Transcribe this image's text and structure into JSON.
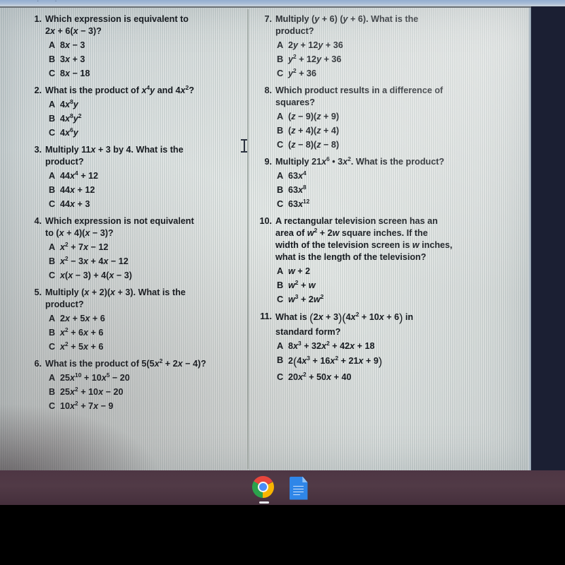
{
  "device": {
    "shelf_color": "#4e3644",
    "desktop_color": "#1b1f33",
    "paper_color": "#dfe5e2"
  },
  "shelf": {
    "items": [
      {
        "name": "chrome-icon",
        "label": "Google Chrome",
        "active": true
      },
      {
        "name": "google-docs-icon",
        "label": "Google Docs",
        "active": false
      }
    ]
  },
  "worksheet": {
    "columns": [
      {
        "id": "left-column",
        "questions": [
          {
            "number": "1.",
            "text_html": "Which expression is equivalent to<br>2<i class=\"v\">x</i> + 6(<i class=\"v\">x</i> &minus; 3)?",
            "options": [
              {
                "letter": "A",
                "html": "8<i class=\"v\">x</i> &minus; 3"
              },
              {
                "letter": "B",
                "html": "3<i class=\"v\">x</i> + 3"
              },
              {
                "letter": "C",
                "html": "8<i class=\"v\">x</i> &minus; 18"
              }
            ]
          },
          {
            "number": "2.",
            "text_html": "What is the product of <i class=\"v\">x</i><sup>4</sup><i class=\"v\">y</i> and 4<i class=\"v\">x</i><sup>2</sup>?",
            "options": [
              {
                "letter": "A",
                "html": "4<i class=\"v\">x</i><sup>8</sup><i class=\"v\">y</i>"
              },
              {
                "letter": "B",
                "html": "4<i class=\"v\">x</i><sup>8</sup><i class=\"v\">y</i><sup>2</sup>"
              },
              {
                "letter": "C",
                "html": "4<i class=\"v\">x</i><sup>6</sup><i class=\"v\">y</i>"
              }
            ]
          },
          {
            "number": "3.",
            "text_html": "Multiply 11<i class=\"v\">x</i> + 3 by 4. What is the<br>product?",
            "options": [
              {
                "letter": "A",
                "html": "44<i class=\"v\">x</i><sup>4</sup> + 12"
              },
              {
                "letter": "B",
                "html": "44<i class=\"v\">x</i> + 12"
              },
              {
                "letter": "C",
                "html": "44<i class=\"v\">x</i> + 3"
              }
            ]
          },
          {
            "number": "4.",
            "text_html": "Which expression is <b>not</b> equivalent<br>to (<i class=\"v\">x</i> + 4)(<i class=\"v\">x</i> &minus; 3)?",
            "options": [
              {
                "letter": "A",
                "html": "<i class=\"v\">x</i><sup>2</sup> + 7<i class=\"v\">x</i> &minus; 12"
              },
              {
                "letter": "B",
                "html": "<i class=\"v\">x</i><sup>2</sup> &minus; 3<i class=\"v\">x</i> + 4<i class=\"v\">x</i> &minus; 12"
              },
              {
                "letter": "C",
                "html": "<i class=\"v\">x</i>(<i class=\"v\">x</i> &minus; 3) + 4(<i class=\"v\">x</i> &minus; 3)"
              }
            ]
          },
          {
            "number": "5.",
            "text_html": "Multiply (<i class=\"v\">x</i> + 2)(<i class=\"v\">x</i> + 3). What is the<br>product?",
            "options": [
              {
                "letter": "A",
                "html": "2<i class=\"v\">x</i> + 5<i class=\"v\">x</i> + 6"
              },
              {
                "letter": "B",
                "html": "<i class=\"v\">x</i><sup>2</sup> + 6<i class=\"v\">x</i> + 6"
              },
              {
                "letter": "C",
                "html": "<i class=\"v\">x</i><sup>2</sup> + 5<i class=\"v\">x</i> + 6"
              }
            ]
          },
          {
            "number": "6.",
            "text_html": "What is the product of 5(5<i class=\"v\">x</i><sup>2</sup> + 2<i class=\"v\">x</i> &minus; 4)?",
            "options": [
              {
                "letter": "A",
                "html": "25<i class=\"v\">x</i><sup>10</sup> + 10<i class=\"v\">x</i><sup>5</sup> &minus; 20"
              },
              {
                "letter": "B",
                "html": "25<i class=\"v\">x</i><sup>2</sup> + 10<i class=\"v\">x</i> &minus; 20"
              },
              {
                "letter": "C",
                "html": "10<i class=\"v\">x</i><sup>2</sup> + 7<i class=\"v\">x</i> &minus; 9"
              }
            ]
          }
        ]
      },
      {
        "id": "right-column",
        "questions": [
          {
            "number": "7.",
            "text_html": "Multiply (<i class=\"v\">y</i> + 6) (<i class=\"v\">y</i> + 6). What is the<br>product?",
            "options": [
              {
                "letter": "A",
                "html": "2<i class=\"v\">y</i> + 12<i class=\"v\">y</i> + 36"
              },
              {
                "letter": "B",
                "html": "<i class=\"v\">y</i><sup>2</sup> + 12<i class=\"v\">y</i> + 36"
              },
              {
                "letter": "C",
                "html": "<i class=\"v\">y</i><sup>2</sup> + 36"
              }
            ]
          },
          {
            "number": "8.",
            "text_html": "Which product results in a difference of<br>squares?",
            "options": [
              {
                "letter": "A",
                "html": "(<i class=\"v\">z</i> &minus; 9)(<i class=\"v\">z</i> + 9)"
              },
              {
                "letter": "B",
                "html": "(<i class=\"v\">z</i> + 4)(<i class=\"v\">z</i> + 4)"
              },
              {
                "letter": "C",
                "html": "(<i class=\"v\">z</i> &minus; 8)(<i class=\"v\">z</i> &minus; 8)"
              }
            ]
          },
          {
            "number": "9.",
            "text_html": "Multiply 21<i class=\"v\">x</i><sup>6</sup> &bull; 3<i class=\"v\">x</i><sup>2</sup>. What is the product?",
            "options": [
              {
                "letter": "A",
                "html": "63<i class=\"v\">x</i><sup>4</sup>"
              },
              {
                "letter": "B",
                "html": "63<i class=\"v\">x</i><sup>8</sup>"
              },
              {
                "letter": "C",
                "html": "63<i class=\"v\">x</i><sup>12</sup>"
              }
            ]
          },
          {
            "number": "10.",
            "text_html": "A rectangular television screen has an<br>area of <i class=\"v\">w</i><sup>2</sup> + 2<i class=\"v\">w</i> square inches. If the<br>width of the television screen is <i class=\"v\">w</i> inches,<br>what is the length of the television?",
            "options": [
              {
                "letter": "A",
                "html": "<i class=\"v\">w</i> + 2"
              },
              {
                "letter": "B",
                "html": "<i class=\"v\">w</i><sup>2</sup> + <i class=\"v\">w</i>"
              },
              {
                "letter": "C",
                "html": "<i class=\"v\">w</i><sup>3</sup> + 2<i class=\"v\">w</i><sup>2</sup>"
              }
            ]
          },
          {
            "number": "11.",
            "text_html": "What is <span class=\"big-paren\">(</span>2<i class=\"v\">x</i> + 3<span class=\"big-paren\">)(</span>4<i class=\"v\">x</i><sup>2</sup> + 10<i class=\"v\">x</i> + 6<span class=\"big-paren\">)</span> in<br>standard form?",
            "options": [
              {
                "letter": "A",
                "html": "8<i class=\"v\">x</i><sup>3</sup> + 32<i class=\"v\">x</i><sup>2</sup> + 42<i class=\"v\">x</i> + 18"
              },
              {
                "letter": "B",
                "html": "2<span class=\"big-paren\">(</span>4<i class=\"v\">x</i><sup>3</sup> + 16<i class=\"v\">x</i><sup>2</sup> + 21<i class=\"v\">x</i> + 9<span class=\"big-paren\">)</span>"
              },
              {
                "letter": "C",
                "html": "20<i class=\"v\">x</i><sup>2</sup> + 50<i class=\"v\">x</i> + 40"
              }
            ]
          }
        ]
      }
    ]
  }
}
